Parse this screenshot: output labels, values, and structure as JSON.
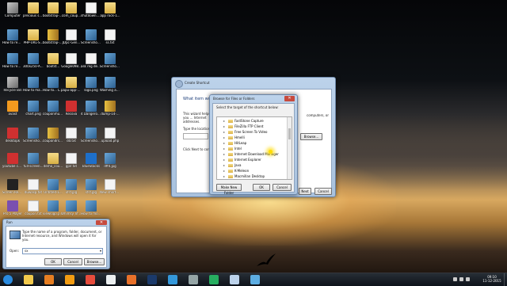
{
  "desktop_icons": [
    {
      "label": "Computer",
      "kind": "app"
    },
    {
      "label": "precious sk...",
      "kind": "folder"
    },
    {
      "label": "bootstrap-3...",
      "kind": "folder"
    },
    {
      "label": "com_coup...",
      "kind": "folder"
    },
    {
      "label": "shutdown.vbs",
      "kind": "doc"
    },
    {
      "label": "app rock-1...",
      "kind": "folder"
    },
    {
      "label": "How to remove my...",
      "kind": "img"
    },
    {
      "label": "PHP-URL-S...",
      "kind": "folder"
    },
    {
      "label": "bootstrap-3...",
      "kind": "zip"
    },
    {
      "label": "JDpc-Gen...",
      "kind": "doc"
    },
    {
      "label": "Screenshot...",
      "kind": "img"
    },
    {
      "label": "ss.txt",
      "kind": "doc"
    },
    {
      "label": "How to remove my...",
      "kind": "img"
    },
    {
      "label": "300x250-Ad-Exam...",
      "kind": "img"
    },
    {
      "label": "bootst...",
      "kind": "folder"
    },
    {
      "label": "Google098...",
      "kind": "doc"
    },
    {
      "label": "ask reg details.txt",
      "kind": "doc"
    },
    {
      "label": "Screenshot...",
      "kind": "img"
    },
    {
      "label": "Recycle Bin",
      "kind": "app"
    },
    {
      "label": "How to make good mark...",
      "kind": "img"
    },
    {
      "label": "How to... LOCKET1_9...",
      "kind": "img"
    },
    {
      "label": "papu-app-a...",
      "kind": "folder"
    },
    {
      "label": "logo.png",
      "kind": "img"
    },
    {
      "label": "Washing auto wide...",
      "kind": "img"
    },
    {
      "label": "avast",
      "kind": "orange"
    },
    {
      "label": "chart.png",
      "kind": "img"
    },
    {
      "label": "couponmusi...",
      "kind": "img"
    },
    {
      "label": "Recova",
      "kind": "red"
    },
    {
      "label": "4 Dangerous computer...",
      "kind": "img"
    },
    {
      "label": "dump-14-...",
      "kind": "zip"
    },
    {
      "label": "desktopk",
      "kind": "red"
    },
    {
      "label": "Screenshot...",
      "kind": "img"
    },
    {
      "label": "coupondrs.zip",
      "kind": "zip"
    },
    {
      "label": "dd.txt",
      "kind": "doc"
    },
    {
      "label": "Screenshot... keyword.def",
      "kind": "img"
    },
    {
      "label": "upload.php",
      "kind": "doc"
    },
    {
      "label": "youtube custo...",
      "kind": "red"
    },
    {
      "label": "full-screen...",
      "kind": "img"
    },
    {
      "label": "demo_cou...",
      "kind": "folder"
    },
    {
      "label": "gplr.txt",
      "kind": "doc"
    },
    {
      "label": "BlueStacks",
      "kind": "blue"
    },
    {
      "label": "dffd.jpg",
      "kind": "img"
    },
    {
      "label": "Screen Recorder",
      "kind": "black"
    },
    {
      "label": "duwasp.txt",
      "kind": "doc"
    },
    {
      "label": "Untitled-1...",
      "kind": "img"
    },
    {
      "label": "xfsf.jpg",
      "kind": "img"
    },
    {
      "label": "sfsf.jpg",
      "kind": "img"
    },
    {
      "label": "New shortcut",
      "kind": "doc"
    },
    {
      "label": "Pro 5 Player",
      "kind": "purple"
    },
    {
      "label": "coupon.txt",
      "kind": "doc"
    },
    {
      "label": "viewlogo.png",
      "kind": "img"
    },
    {
      "label": "Whimsy. life...",
      "kind": "img"
    },
    {
      "label": "How to move...",
      "kind": "img"
    }
  ],
  "wizard": {
    "title": "Create Shortcut",
    "heading": "What item wou...",
    "desc": "This wizard helps you ... Internet addresses.",
    "desc_right": "computers, or",
    "location_label": "Type the location o...",
    "browse_label": "Browse...",
    "hint": "Click Next to contin...",
    "next_label": "Next",
    "cancel_label": "Cancel"
  },
  "browse": {
    "title": "Browse for Files or Folders",
    "instruction": "Select the target of the shortcut below:",
    "items": [
      "FastStone Capture",
      "FileZilla FTP Client",
      "Free Screen To Video",
      "Hmelli",
      "HitLeap",
      "Intel",
      "Internet Download Manager",
      "Internet Explorer",
      "Java",
      "K-Meleon",
      "Macmillan Desktop"
    ],
    "make_folder": "Make New Folder",
    "ok": "OK",
    "cancel": "Cancel"
  },
  "run": {
    "title": "Run",
    "desc": "Type the name of a program, folder, document, or Internet resource, and Windows will open it for you.",
    "open_label": "Open:",
    "open_value": "sx",
    "ok": "OK",
    "cancel": "Cancel",
    "browse": "Browse..."
  },
  "clock": {
    "time": "09:10",
    "date": "11-12-2015"
  },
  "taskbar_icons": [
    "start-orb",
    "explorer",
    "media",
    "vlc",
    "chrome",
    "notepad",
    "firefox",
    "photoshop",
    "chrome-alt",
    "paint",
    "screen-capture",
    "run-window",
    "ie-window"
  ]
}
